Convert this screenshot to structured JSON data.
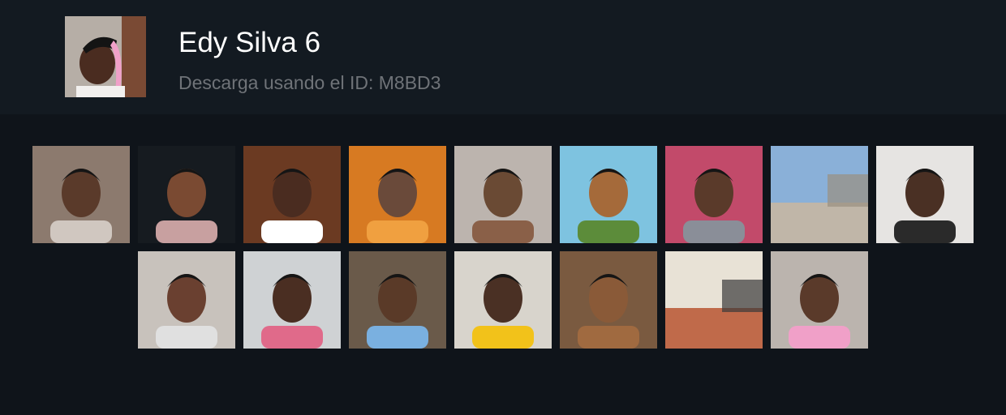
{
  "pack": {
    "title": "Edy Silva 6",
    "subtitle": "Descarga usando el ID: M8BD3",
    "thumbnail_icon": "person-portrait-icon"
  },
  "stickers": [
    {
      "name": "sticker-1",
      "icon": "person-selfie-icon",
      "bg": "#8c7a6e",
      "skin": "#5a3a2a",
      "accent": "#d0c7c0"
    },
    {
      "name": "sticker-2",
      "icon": "cartoon-avatar-icon",
      "bg": "#161b20",
      "skin": "#7a4a32",
      "accent": "#c8a0a0"
    },
    {
      "name": "sticker-3",
      "icon": "person-selfie-icon",
      "bg": "#6b3a22",
      "skin": "#4a2c20",
      "accent": "#ffffff"
    },
    {
      "name": "sticker-4",
      "icon": "person-face-filter-icon",
      "bg": "#d77a22",
      "skin": "#6a4a3a",
      "accent": "#f0a040"
    },
    {
      "name": "sticker-5",
      "icon": "person-face-filter-icon",
      "bg": "#bcb4ae",
      "skin": "#6a4a34",
      "accent": "#8a6048"
    },
    {
      "name": "sticker-6",
      "icon": "cartoon-avatar-icon",
      "bg": "#7ec3e0",
      "skin": "#a56a3a",
      "accent": "#5c8c3a"
    },
    {
      "name": "sticker-7",
      "icon": "person-face-filter-icon",
      "bg": "#c24a6a",
      "skin": "#5a3a2a",
      "accent": "#8a8e98"
    },
    {
      "name": "sticker-8",
      "icon": "street-scene-icon",
      "bg": "#8ab0d8",
      "skin": "#9a9080",
      "accent": "#c0b6a8"
    },
    {
      "name": "sticker-9",
      "icon": "person-selfie-icon",
      "bg": "#e6e4e2",
      "skin": "#4a3024",
      "accent": "#2a2a2a"
    },
    {
      "name": "sticker-10",
      "icon": "person-selfie-icon",
      "bg": "#c8c2bc",
      "skin": "#6a4030",
      "accent": "#e0e0e0"
    },
    {
      "name": "sticker-11",
      "icon": "person-selfie-icon",
      "bg": "#cfd2d4",
      "skin": "#4a2e22",
      "accent": "#e06a8a"
    },
    {
      "name": "sticker-12",
      "icon": "person-selfie-icon",
      "bg": "#6a5a4a",
      "skin": "#5a3a28",
      "accent": "#7ab0e0"
    },
    {
      "name": "sticker-13",
      "icon": "person-selfie-icon",
      "bg": "#d8d4cc",
      "skin": "#4a3024",
      "accent": "#f2c21a"
    },
    {
      "name": "sticker-14",
      "icon": "person-selfie-icon",
      "bg": "#7a5a40",
      "skin": "#8a5a38",
      "accent": "#a06a40"
    },
    {
      "name": "sticker-15",
      "icon": "street-scene-icon",
      "bg": "#e8e2d6",
      "skin": "#3a3a3a",
      "accent": "#c06a4a"
    },
    {
      "name": "sticker-16",
      "icon": "person-portrait-icon",
      "bg": "#bbb4ae",
      "skin": "#5a3a2a",
      "accent": "#f0a0c8"
    }
  ]
}
